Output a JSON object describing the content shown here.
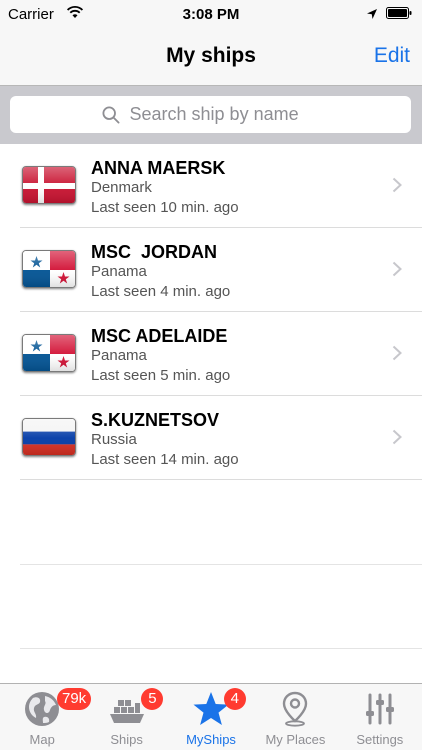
{
  "status_bar": {
    "carrier": "Carrier",
    "time": "3:08 PM"
  },
  "nav": {
    "title": "My ships",
    "edit_label": "Edit"
  },
  "search": {
    "placeholder": "Search ship by name"
  },
  "ships": [
    {
      "name": "ANNA MAERSK",
      "country": "Denmark",
      "last_seen": "Last seen 10 min. ago",
      "flag": "denmark-flag"
    },
    {
      "name": "MSC  JORDAN",
      "country": "Panama",
      "last_seen": "Last seen 4 min. ago",
      "flag": "panama-flag"
    },
    {
      "name": "MSC ADELAIDE",
      "country": "Panama",
      "last_seen": "Last seen 5 min. ago",
      "flag": "panama-flag"
    },
    {
      "name": "S.KUZNETSOV",
      "country": "Russia",
      "last_seen": "Last seen 14 min. ago",
      "flag": "russia-flag"
    }
  ],
  "tabs": [
    {
      "label": "Map",
      "badge": "79k",
      "icon": "globe-icon"
    },
    {
      "label": "Ships",
      "badge": "5",
      "icon": "cargo-ship-icon"
    },
    {
      "label": "MyShips",
      "badge": "4",
      "icon": "star-icon",
      "active": true
    },
    {
      "label": "My Places",
      "badge": "",
      "icon": "location-pin-icon"
    },
    {
      "label": "Settings",
      "badge": "",
      "icon": "sliders-icon"
    }
  ],
  "colors": {
    "accent": "#1a73e8",
    "badge": "#ff3b30",
    "search_background": "#c9c9ce"
  }
}
